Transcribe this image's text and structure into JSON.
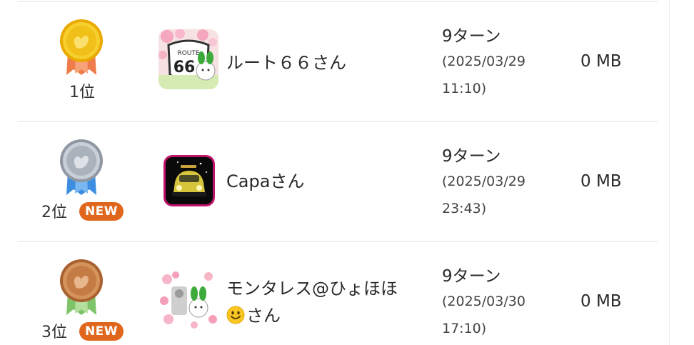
{
  "rows": [
    {
      "rank": "1位",
      "medal": "gold-medal-icon",
      "new_badge": "",
      "avatar": "route66-avatar",
      "name": "ルート６６さん",
      "turns": "9ターン",
      "date_line1": "(2025/03/29",
      "date_line2": "11:10)",
      "size": "0 MB"
    },
    {
      "rank": "2位",
      "medal": "silver-medal-icon",
      "new_badge": "NEW",
      "avatar": "capa-avatar",
      "name": "Capaさん",
      "turns": "9ターン",
      "date_line1": "(2025/03/29",
      "date_line2": "23:43)",
      "size": "0 MB"
    },
    {
      "rank": "3位",
      "medal": "bronze-medal-icon",
      "new_badge": "NEW",
      "avatar": "montaress-avatar",
      "name_line1": "モンタレス@ひょほほ",
      "name_line2": "さん",
      "turns": "9ターン",
      "date_line1": "(2025/03/30",
      "date_line2": "17:10)",
      "size": "0 MB"
    }
  ],
  "colors": {
    "gold": "#f2c21b",
    "silver": "#b9c0c9",
    "bronze": "#c9814a",
    "new_badge": "#e0661b",
    "row_divider": "#e3e3e3"
  }
}
